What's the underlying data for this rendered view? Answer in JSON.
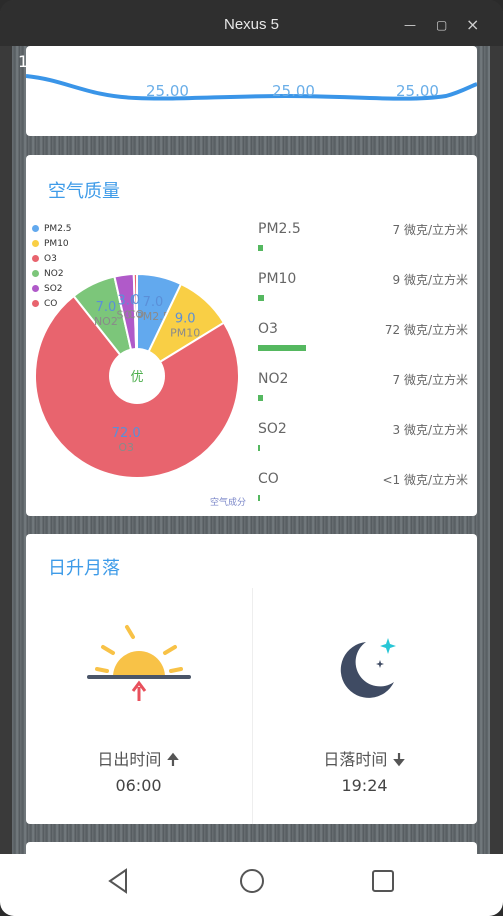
{
  "emulator": {
    "title": "Nexus 5",
    "minimize": "—",
    "maximize": "▢",
    "close": "×"
  },
  "statusbar": {
    "time": "13:50"
  },
  "temp_card": {
    "labels": [
      "25.00",
      "25.00",
      "25.00"
    ]
  },
  "aqi_card": {
    "title": "空气质量",
    "center_label": "优",
    "caption": "空气成分",
    "colors": {
      "PM2.5": "#62a9ee",
      "PM10": "#f9cf45",
      "O3": "#e8646e",
      "NO2": "#7cc67a",
      "SO2": "#b05ac9",
      "CO": "#e8646e"
    },
    "items": [
      {
        "name": "PM2.5",
        "value": "7 微克/立方米",
        "level": 7
      },
      {
        "name": "PM10",
        "value": "9 微克/立方米",
        "level": 9
      },
      {
        "name": "O3",
        "value": "72 微克/立方米",
        "level": 72
      },
      {
        "name": "NO2",
        "value": "7 微克/立方米",
        "level": 7
      },
      {
        "name": "SO2",
        "value": "3 微克/立方米",
        "level": 3
      },
      {
        "name": "CO",
        "value": "<1 微克/立方米",
        "level": 0.5
      }
    ],
    "legend": [
      "PM2.5",
      "PM10",
      "O3",
      "NO2",
      "SO2",
      "CO"
    ],
    "slice_labels": [
      "7.0",
      "9.0",
      "72.0",
      "7.0",
      "3.0",
      "0"
    ],
    "slice_names": [
      "PM2.5",
      "PM10",
      "O3",
      "NO2",
      "SO2",
      "CO"
    ]
  },
  "chart_data": {
    "type": "pie",
    "categories": [
      "PM2.5",
      "PM10",
      "O3",
      "NO2",
      "SO2",
      "CO"
    ],
    "values": [
      7,
      9,
      72,
      7,
      3,
      0.5
    ],
    "title": "",
    "caption": "空气成分"
  },
  "sun_card": {
    "title": "日升月落",
    "sunrise_label": "日出时间",
    "sunrise_time": "06:00",
    "sunset_label": "日落时间",
    "sunset_time": "19:24"
  }
}
